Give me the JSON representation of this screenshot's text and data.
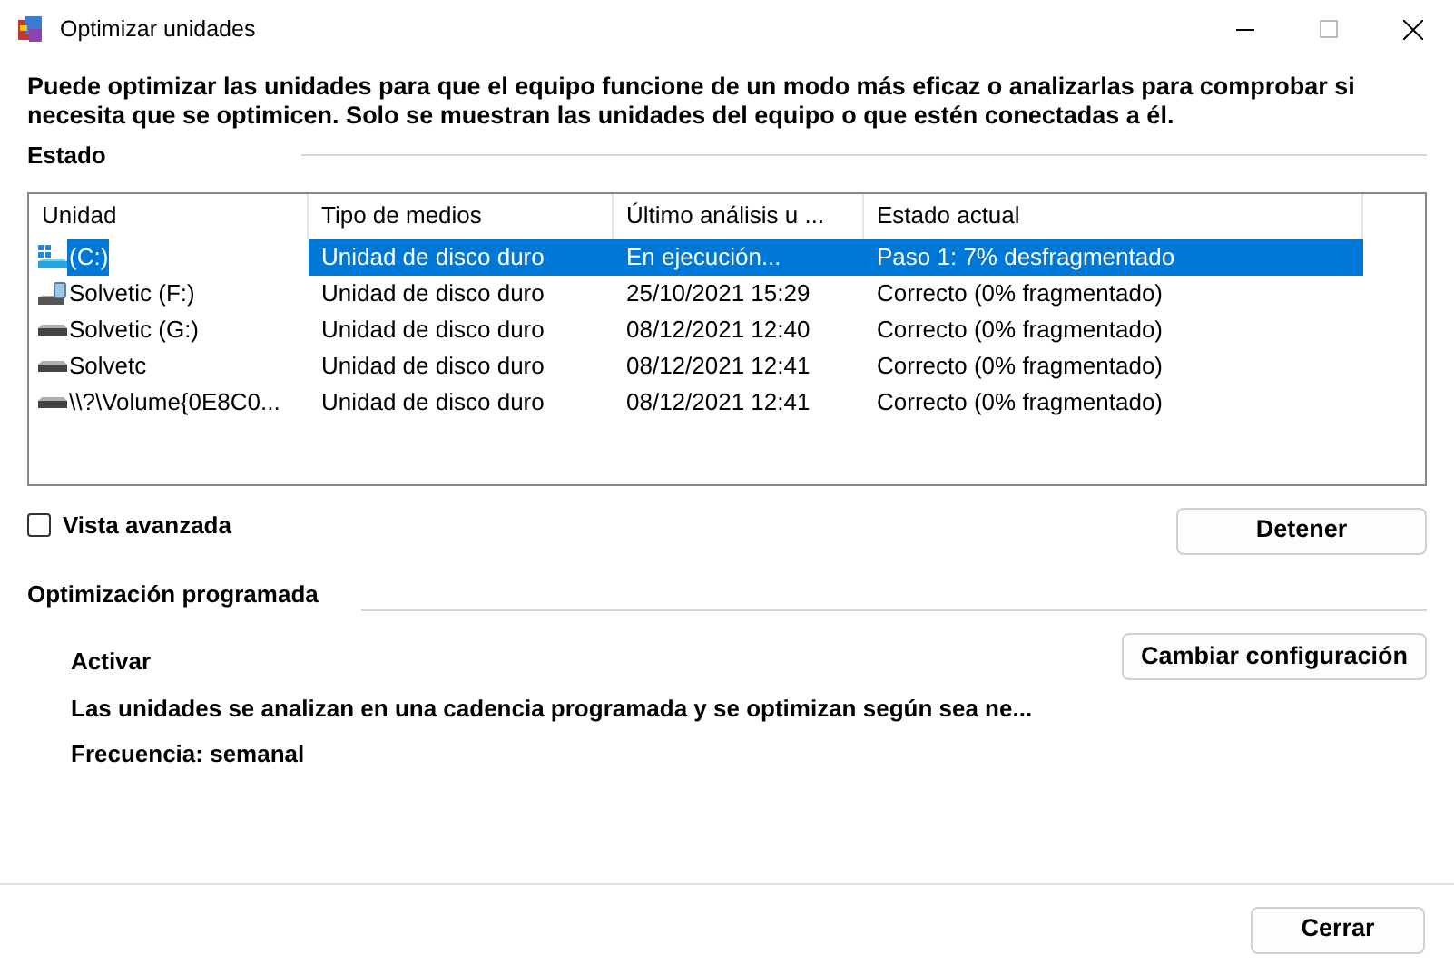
{
  "window": {
    "title": "Optimizar unidades"
  },
  "description": "Puede optimizar las unidades para que el equipo funcione de un modo más eficaz o analizarlas para comprobar si necesita que se optimicen. Solo se muestran las unidades del equipo o que estén conectadas a él.",
  "status_section": {
    "title": "Estado"
  },
  "table": {
    "columns": [
      "Unidad",
      "Tipo de medios",
      "Último análisis u ...",
      "Estado actual"
    ],
    "rows": [
      {
        "kind": "system",
        "selected": true,
        "cells": [
          "(C:)",
          "Unidad de disco duro",
          "En ejecución...",
          "Paso 1: 7% desfragmentado"
        ]
      },
      {
        "kind": "external",
        "selected": false,
        "cells": [
          "Solvetic (F:)",
          "Unidad de disco duro",
          "25/10/2021 15:29",
          "Correcto (0% fragmentado)"
        ]
      },
      {
        "kind": "disk",
        "selected": false,
        "cells": [
          "Solvetic (G:)",
          "Unidad de disco duro",
          "08/12/2021 12:40",
          "Correcto (0% fragmentado)"
        ]
      },
      {
        "kind": "disk",
        "selected": false,
        "cells": [
          "Solvetc",
          "Unidad de disco duro",
          "08/12/2021 12:41",
          "Correcto (0% fragmentado)"
        ]
      },
      {
        "kind": "disk",
        "selected": false,
        "cells": [
          "\\\\?\\Volume{0E8C0...",
          "Unidad de disco duro",
          "08/12/2021 12:41",
          "Correcto (0% fragmentado)"
        ]
      }
    ]
  },
  "advanced_view": {
    "label": "Vista avanzada",
    "checked": false
  },
  "stop_button": "Detener",
  "schedule": {
    "title": "Optimización programada",
    "state": "Activar",
    "description": "Las unidades se analizan en una cadencia programada y se optimizan según sea ne...",
    "frequency": "Frecuencia: semanal",
    "button": "Cambiar configuración"
  },
  "close_button": "Cerrar"
}
